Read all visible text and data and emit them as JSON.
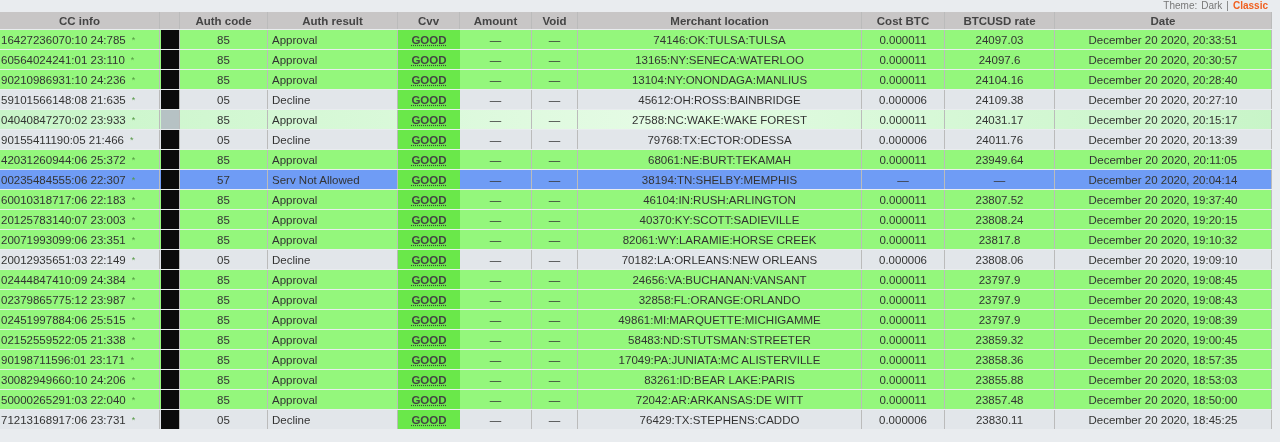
{
  "theme_switch": {
    "label": "Theme:",
    "separator": "|",
    "options": [
      {
        "label": "Dark",
        "selected": false
      },
      {
        "label": "Classic",
        "selected": true
      }
    ]
  },
  "table": {
    "columns": [
      "CC info",
      "",
      "Auth code",
      "Auth result",
      "Cvv",
      "Amount",
      "Void",
      "Merchant location",
      "Cost BTC",
      "BTCUSD rate",
      "Date"
    ],
    "rows": [
      {
        "cc_info": "16427236070:10 24:785",
        "mark": "*",
        "kind": "approval",
        "hovered": false,
        "auth_code": "85",
        "auth_result": "Approval",
        "cvv": "GOOD",
        "amount": "—",
        "void": "—",
        "merchant_location": "74146:OK:TULSA:TULSA",
        "cost_btc": "0.000011",
        "btcusd_rate": "24097.03",
        "date": "December 20 2020, 20:33:51"
      },
      {
        "cc_info": "60564024241:01 23:110",
        "mark": "*",
        "kind": "approval",
        "hovered": false,
        "auth_code": "85",
        "auth_result": "Approval",
        "cvv": "GOOD",
        "amount": "—",
        "void": "—",
        "merchant_location": "13165:NY:SENECA:WATERLOO",
        "cost_btc": "0.000011",
        "btcusd_rate": "24097.6",
        "date": "December 20 2020, 20:30:57"
      },
      {
        "cc_info": "90210986931:10 24:236",
        "mark": "*",
        "kind": "approval",
        "hovered": false,
        "auth_code": "85",
        "auth_result": "Approval",
        "cvv": "GOOD",
        "amount": "—",
        "void": "—",
        "merchant_location": "13104:NY:ONONDAGA:MANLIUS",
        "cost_btc": "0.000011",
        "btcusd_rate": "24104.16",
        "date": "December 20 2020, 20:28:40"
      },
      {
        "cc_info": "59101566148:08 21:635",
        "mark": "*",
        "kind": "decline",
        "hovered": false,
        "auth_code": "05",
        "auth_result": "Decline",
        "cvv": "GOOD",
        "amount": "—",
        "void": "—",
        "merchant_location": "45612:OH:ROSS:BAINBRIDGE",
        "cost_btc": "0.000006",
        "btcusd_rate": "24109.38",
        "date": "December 20 2020, 20:27:10"
      },
      {
        "cc_info": "04040847270:02 23:933",
        "mark": "*",
        "kind": "approval",
        "hovered": true,
        "auth_code": "85",
        "auth_result": "Approval",
        "cvv": "GOOD",
        "amount": "—",
        "void": "—",
        "merchant_location": "27588:NC:WAKE:WAKE FOREST",
        "cost_btc": "0.000011",
        "btcusd_rate": "24031.17",
        "date": "December 20 2020, 20:15:17"
      },
      {
        "cc_info": "90155411190:05 21:466",
        "mark": "*",
        "kind": "decline",
        "hovered": false,
        "auth_code": "05",
        "auth_result": "Decline",
        "cvv": "GOOD",
        "amount": "—",
        "void": "—",
        "merchant_location": "79768:TX:ECTOR:ODESSA",
        "cost_btc": "0.000006",
        "btcusd_rate": "24011.76",
        "date": "December 20 2020, 20:13:39"
      },
      {
        "cc_info": "42031260944:06 25:372",
        "mark": "*",
        "kind": "approval",
        "hovered": false,
        "auth_code": "85",
        "auth_result": "Approval",
        "cvv": "GOOD",
        "amount": "—",
        "void": "—",
        "merchant_location": "68061:NE:BURT:TEKAMAH",
        "cost_btc": "0.000011",
        "btcusd_rate": "23949.64",
        "date": "December 20 2020, 20:11:05"
      },
      {
        "cc_info": "00235484555:06 22:307",
        "mark": "*",
        "kind": "blocked",
        "hovered": false,
        "auth_code": "57",
        "auth_result": "Serv Not Allowed",
        "cvv": "GOOD",
        "amount": "—",
        "void": "—",
        "merchant_location": "38194:TN:SHELBY:MEMPHIS",
        "cost_btc": "—",
        "btcusd_rate": "—",
        "date": "December 20 2020, 20:04:14"
      },
      {
        "cc_info": "60010318717:06 22:183",
        "mark": "*",
        "kind": "approval",
        "hovered": false,
        "auth_code": "85",
        "auth_result": "Approval",
        "cvv": "GOOD",
        "amount": "—",
        "void": "—",
        "merchant_location": "46104:IN:RUSH:ARLINGTON",
        "cost_btc": "0.000011",
        "btcusd_rate": "23807.52",
        "date": "December 20 2020, 19:37:40"
      },
      {
        "cc_info": "20125783140:07 23:003",
        "mark": "*",
        "kind": "approval",
        "hovered": false,
        "auth_code": "85",
        "auth_result": "Approval",
        "cvv": "GOOD",
        "amount": "—",
        "void": "—",
        "merchant_location": "40370:KY:SCOTT:SADIEVILLE",
        "cost_btc": "0.000011",
        "btcusd_rate": "23808.24",
        "date": "December 20 2020, 19:20:15"
      },
      {
        "cc_info": "20071993099:06 23:351",
        "mark": "*",
        "kind": "approval",
        "hovered": false,
        "auth_code": "85",
        "auth_result": "Approval",
        "cvv": "GOOD",
        "amount": "—",
        "void": "—",
        "merchant_location": "82061:WY:LARAMIE:HORSE CREEK",
        "cost_btc": "0.000011",
        "btcusd_rate": "23817.8",
        "date": "December 20 2020, 19:10:32"
      },
      {
        "cc_info": "20012935651:03 22:149",
        "mark": "*",
        "kind": "decline",
        "hovered": false,
        "auth_code": "05",
        "auth_result": "Decline",
        "cvv": "GOOD",
        "amount": "—",
        "void": "—",
        "merchant_location": "70182:LA:ORLEANS:NEW ORLEANS",
        "cost_btc": "0.000006",
        "btcusd_rate": "23808.06",
        "date": "December 20 2020, 19:09:10"
      },
      {
        "cc_info": "02444847410:09 24:384",
        "mark": "*",
        "kind": "approval",
        "hovered": false,
        "auth_code": "85",
        "auth_result": "Approval",
        "cvv": "GOOD",
        "amount": "—",
        "void": "—",
        "merchant_location": "24656:VA:BUCHANAN:VANSANT",
        "cost_btc": "0.000011",
        "btcusd_rate": "23797.9",
        "date": "December 20 2020, 19:08:45"
      },
      {
        "cc_info": "02379865775:12 23:987",
        "mark": "*",
        "kind": "approval",
        "hovered": false,
        "auth_code": "85",
        "auth_result": "Approval",
        "cvv": "GOOD",
        "amount": "—",
        "void": "—",
        "merchant_location": "32858:FL:ORANGE:ORLANDO",
        "cost_btc": "0.000011",
        "btcusd_rate": "23797.9",
        "date": "December 20 2020, 19:08:43"
      },
      {
        "cc_info": "02451997884:06 25:515",
        "mark": "*",
        "kind": "approval",
        "hovered": false,
        "auth_code": "85",
        "auth_result": "Approval",
        "cvv": "GOOD",
        "amount": "—",
        "void": "—",
        "merchant_location": "49861:MI:MARQUETTE:MICHIGAMME",
        "cost_btc": "0.000011",
        "btcusd_rate": "23797.9",
        "date": "December 20 2020, 19:08:39"
      },
      {
        "cc_info": "02152559522:05 21:338",
        "mark": "*",
        "kind": "approval",
        "hovered": false,
        "auth_code": "85",
        "auth_result": "Approval",
        "cvv": "GOOD",
        "amount": "—",
        "void": "—",
        "merchant_location": "58483:ND:STUTSMAN:STREETER",
        "cost_btc": "0.000011",
        "btcusd_rate": "23859.32",
        "date": "December 20 2020, 19:00:45"
      },
      {
        "cc_info": "90198711596:01 23:171",
        "mark": "*",
        "kind": "approval",
        "hovered": false,
        "auth_code": "85",
        "auth_result": "Approval",
        "cvv": "GOOD",
        "amount": "—",
        "void": "—",
        "merchant_location": "17049:PA:JUNIATA:MC ALISTERVILLE",
        "cost_btc": "0.000011",
        "btcusd_rate": "23858.36",
        "date": "December 20 2020, 18:57:35"
      },
      {
        "cc_info": "30082949660:10 24:206",
        "mark": "*",
        "kind": "approval",
        "hovered": false,
        "auth_code": "85",
        "auth_result": "Approval",
        "cvv": "GOOD",
        "amount": "—",
        "void": "—",
        "merchant_location": "83261:ID:BEAR LAKE:PARIS",
        "cost_btc": "0.000011",
        "btcusd_rate": "23855.88",
        "date": "December 20 2020, 18:53:03"
      },
      {
        "cc_info": "50000265291:03 22:040",
        "mark": "*",
        "kind": "approval",
        "hovered": false,
        "auth_code": "85",
        "auth_result": "Approval",
        "cvv": "GOOD",
        "amount": "—",
        "void": "—",
        "merchant_location": "72042:AR:ARKANSAS:DE WITT",
        "cost_btc": "0.000011",
        "btcusd_rate": "23857.48",
        "date": "December 20 2020, 18:50:00"
      },
      {
        "cc_info": "71213168917:06 23:731",
        "mark": "*",
        "kind": "decline",
        "hovered": false,
        "auth_code": "05",
        "auth_result": "Decline",
        "cvv": "GOOD",
        "amount": "—",
        "void": "—",
        "merchant_location": "76429:TX:STEPHENS:CADDO",
        "cost_btc": "0.000006",
        "btcusd_rate": "23830.11",
        "date": "December 20 2020, 18:45:25"
      }
    ]
  }
}
